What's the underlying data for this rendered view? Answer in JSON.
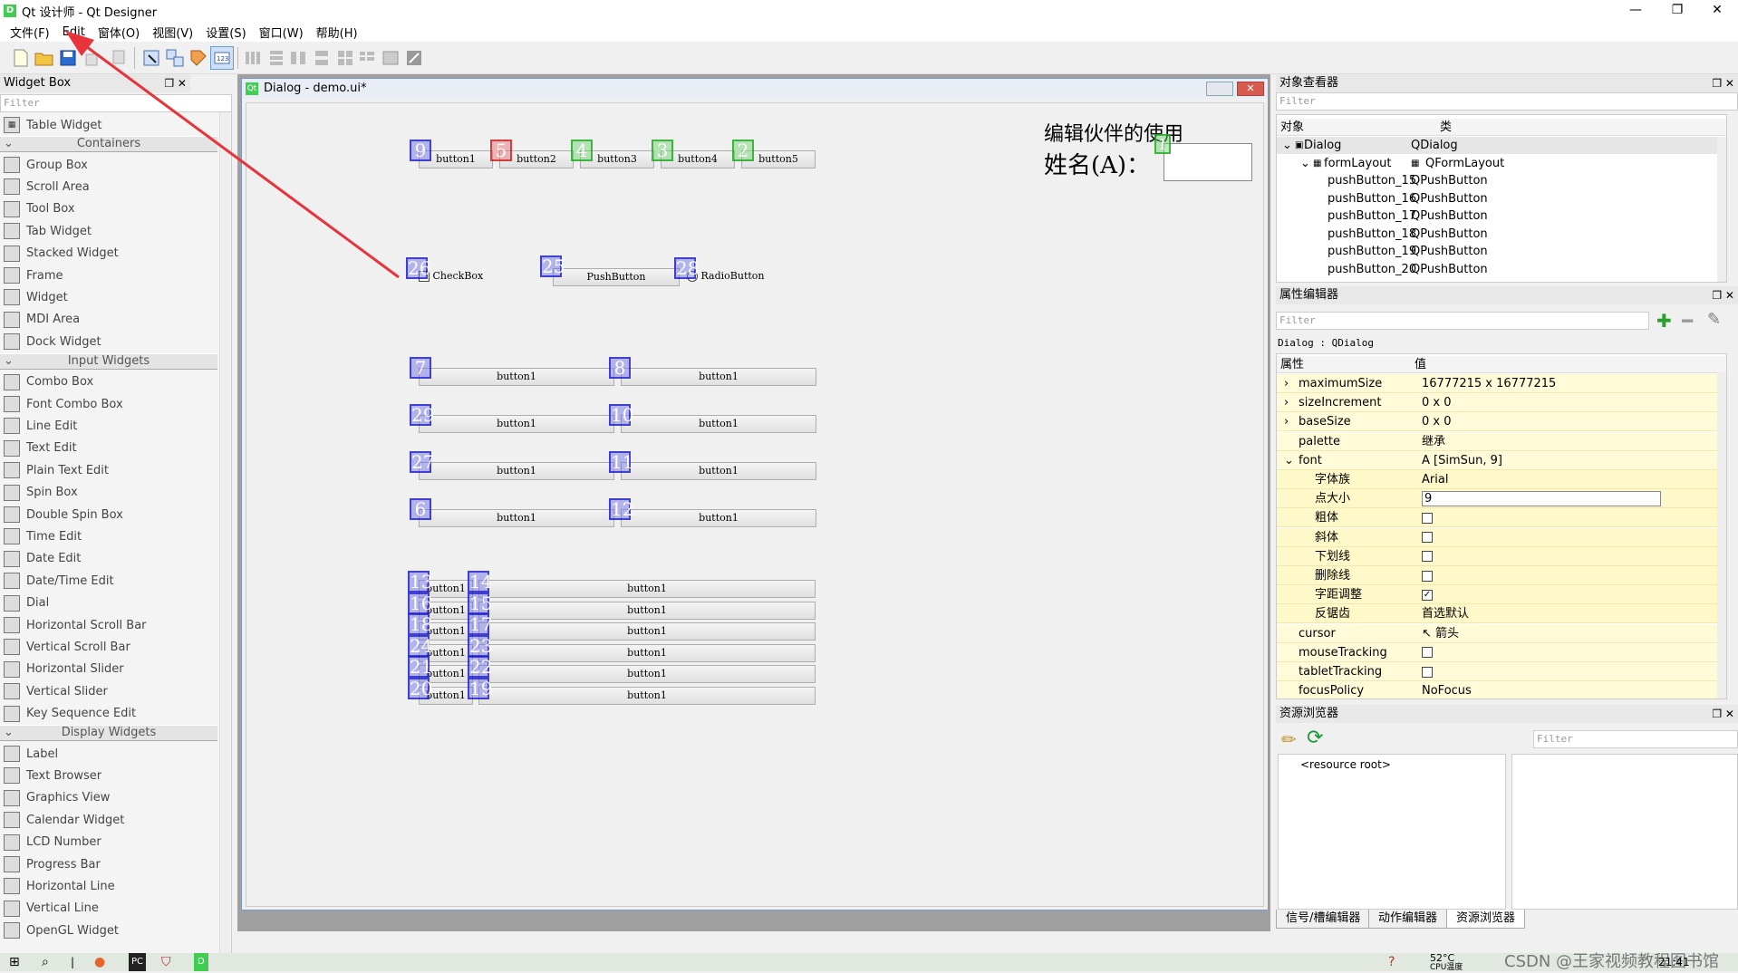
{
  "app": {
    "title": "Qt 设计师 - Qt Designer",
    "icon": "D"
  },
  "window_controls": {
    "minimize": "—",
    "maximize": "❐",
    "close": "✕"
  },
  "menu": [
    "文件(F)",
    "Edit",
    "窗体(O)",
    "视图(V)",
    "设置(S)",
    "窗口(W)",
    "帮助(H)"
  ],
  "widget_box": {
    "title": "Widget Box",
    "filter_placeholder": "Filter",
    "top_item": "Table Widget",
    "categories": [
      {
        "name": "Containers",
        "items": [
          "Group Box",
          "Scroll Area",
          "Tool Box",
          "Tab Widget",
          "Stacked Widget",
          "Frame",
          "Widget",
          "MDI Area",
          "Dock Widget"
        ]
      },
      {
        "name": "Input Widgets",
        "items": [
          "Combo Box",
          "Font Combo Box",
          "Line Edit",
          "Text Edit",
          "Plain Text Edit",
          "Spin Box",
          "Double Spin Box",
          "Time Edit",
          "Date Edit",
          "Date/Time Edit",
          "Dial",
          "Horizontal Scroll Bar",
          "Vertical Scroll Bar",
          "Horizontal Slider",
          "Vertical Slider",
          "Key Sequence Edit"
        ]
      },
      {
        "name": "Display Widgets",
        "items": [
          "Label",
          "Text Browser",
          "Graphics View",
          "Calendar Widget",
          "LCD Number",
          "Progress Bar",
          "Horizontal Line",
          "Vertical Line",
          "OpenGL Widget"
        ]
      }
    ]
  },
  "dialog": {
    "title": "Dialog - demo.ui*",
    "heading": "编辑伙伴的使用",
    "name_label": "姓名(A)：",
    "checkbox": "CheckBox",
    "pushbutton": "PushButton",
    "radiobutton": "RadioButton",
    "row1_buttons": [
      "button1",
      "button2",
      "button3",
      "button4",
      "button5"
    ],
    "row1_tags": [
      "9",
      "5",
      "4",
      "3",
      "2"
    ],
    "edit_tag": "1",
    "row_mid_tags": [
      "26",
      "25",
      "28"
    ],
    "pair_rows": [
      {
        "left": "button1",
        "right": "button1",
        "ltag": "7",
        "rtag": "8"
      },
      {
        "left": "button1",
        "right": "button1",
        "ltag": "29",
        "rtag": "10"
      },
      {
        "left": "button1",
        "right": "button1",
        "ltag": "27",
        "rtag": "11"
      },
      {
        "left": "button1",
        "right": "button1",
        "ltag": "6",
        "rtag": "12"
      }
    ],
    "form_rows": [
      {
        "left": "button1",
        "right": "button1",
        "ltag": "13",
        "rtag": "14"
      },
      {
        "left": "button1",
        "right": "button1",
        "ltag": "16",
        "rtag": "15"
      },
      {
        "left": "button1",
        "right": "button1",
        "ltag": "18",
        "rtag": "17"
      },
      {
        "left": "button1",
        "right": "button1",
        "ltag": "24",
        "rtag": "23"
      },
      {
        "left": "button1",
        "right": "button1",
        "ltag": "21",
        "rtag": "22"
      },
      {
        "left": "button1",
        "right": "button1",
        "ltag": "20",
        "rtag": "19"
      }
    ]
  },
  "object_inspector": {
    "title": "对象查看器",
    "filter_placeholder": "Filter",
    "col_object": "对象",
    "col_class": "类",
    "rows": [
      {
        "name": "Dialog",
        "cls": "QDialog"
      },
      {
        "name": "formLayout",
        "cls": "QFormLayout"
      },
      {
        "name": "pushButton_15",
        "cls": "QPushButton"
      },
      {
        "name": "pushButton_16",
        "cls": "QPushButton"
      },
      {
        "name": "pushButton_17",
        "cls": "QPushButton"
      },
      {
        "name": "pushButton_18",
        "cls": "QPushButton"
      },
      {
        "name": "pushButton_19",
        "cls": "QPushButton"
      },
      {
        "name": "pushButton_20",
        "cls": "QPushButton"
      }
    ]
  },
  "property_editor": {
    "title": "属性编辑器",
    "filter_placeholder": "Filter",
    "context": "Dialog : QDialog",
    "col_prop": "属性",
    "col_value": "值",
    "rows": [
      {
        "name": "maximumSize",
        "value": "16777215 x 16777215"
      },
      {
        "name": "sizeIncrement",
        "value": "0 x 0"
      },
      {
        "name": "baseSize",
        "value": "0 x 0"
      },
      {
        "name": "palette",
        "value": "继承"
      },
      {
        "name": "font",
        "value": "[SimSun, 9]"
      },
      {
        "name": "字体族",
        "value": "Arial"
      },
      {
        "name": "点大小",
        "value": "9"
      },
      {
        "name": "粗体",
        "value": ""
      },
      {
        "name": "斜体",
        "value": ""
      },
      {
        "name": "下划线",
        "value": ""
      },
      {
        "name": "删除线",
        "value": ""
      },
      {
        "name": "字距调整",
        "value": "✓"
      },
      {
        "name": "反锯齿",
        "value": "首选默认"
      },
      {
        "name": "cursor",
        "value": "箭头"
      },
      {
        "name": "mouseTracking",
        "value": ""
      },
      {
        "name": "tabletTracking",
        "value": ""
      },
      {
        "name": "focusPolicy",
        "value": "NoFocus"
      }
    ]
  },
  "resource_browser": {
    "title": "资源浏览器",
    "filter_placeholder": "Filter",
    "root": "<resource root>",
    "tabs": [
      "信号/槽编辑器",
      "动作编辑器",
      "资源浏览器"
    ]
  },
  "taskbar": {
    "temp": "52°C",
    "temp_label": "CPU温度",
    "time": "21:41",
    "watermark": "CSDN @王家视频教程图书馆"
  },
  "colors": {
    "accent": "#41cd52",
    "arrow": "#e8333a",
    "prop_bg": "#fffbd8"
  }
}
